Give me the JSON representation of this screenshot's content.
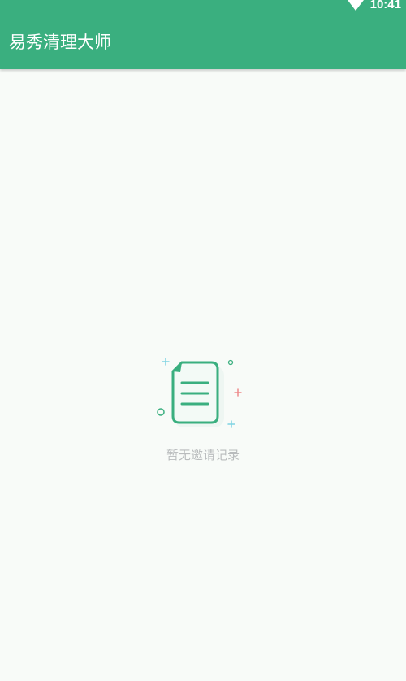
{
  "status_bar": {
    "time": "10:41",
    "icons": [
      "wifi-icon"
    ]
  },
  "app_bar": {
    "title": "易秀清理大师"
  },
  "empty_state": {
    "icon": "document-icon",
    "message": "暂无邀请记录"
  },
  "colors": {
    "primary": "#3aaf7f",
    "background": "#f8fbf8",
    "muted_text": "#b9bcbd",
    "accent_pink": "#ee8a8a",
    "accent_cyan": "#7fd3e2"
  }
}
